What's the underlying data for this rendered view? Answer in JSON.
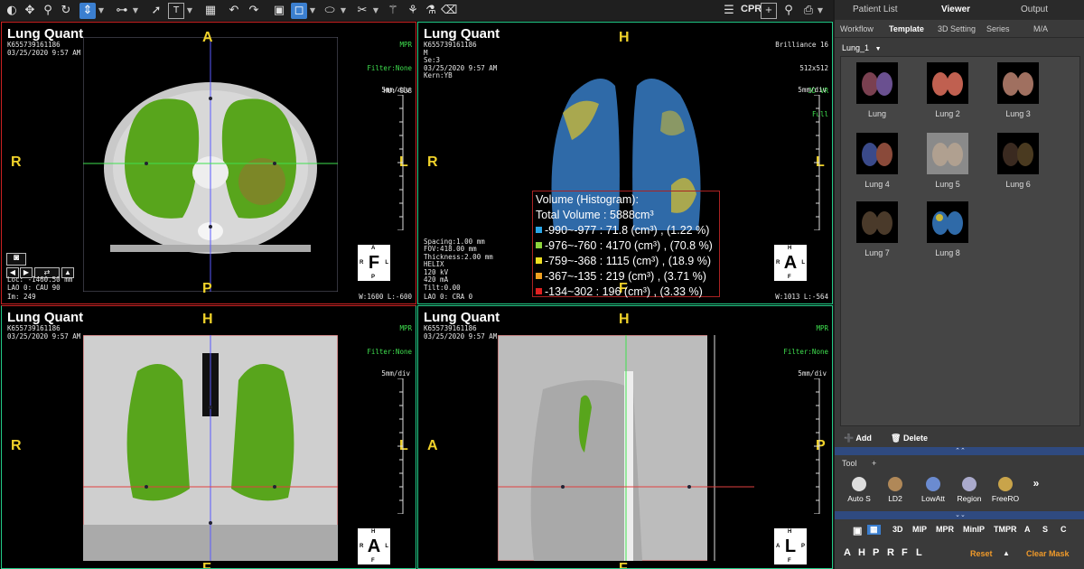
{
  "toolbar": {
    "cpr_label": "CPR"
  },
  "panel": {
    "tabs": [
      "Patient List",
      "Viewer",
      "Output"
    ],
    "selected_tab": "Viewer",
    "sub_tabs": [
      "Workflow",
      "Template",
      "3D Setting",
      "Series",
      "M/A"
    ],
    "selected_sub_tab": "Template",
    "template_select": "Lung_1",
    "thumbnails": [
      {
        "label": "Lung"
      },
      {
        "label": "Lung 2"
      },
      {
        "label": "Lung 3"
      },
      {
        "label": "Lung 4"
      },
      {
        "label": "Lung 5"
      },
      {
        "label": "Lung 6"
      },
      {
        "label": "Lung 7"
      },
      {
        "label": "Lung 8"
      }
    ],
    "add_label": "Add",
    "delete_label": "Delete",
    "tool_header": "Tool",
    "tool_plus": "+",
    "tools": [
      {
        "label": "Auto S",
        "icon": "auto-segment-icon"
      },
      {
        "label": "LD2",
        "icon": "lung-icon"
      },
      {
        "label": "LowAtt",
        "icon": "low-attenuation-icon"
      },
      {
        "label": "Region",
        "icon": "region-icon"
      },
      {
        "label": "FreeRO",
        "icon": "free-roi-icon"
      }
    ],
    "more_label": "»",
    "modes": [
      "3D",
      "MIP",
      "MPR",
      "MinIP",
      "TMPR",
      "A",
      "S",
      "C"
    ],
    "orientations": [
      "A",
      "H",
      "P",
      "R",
      "F",
      "L"
    ],
    "reset_label": "Reset",
    "clear_mask_label": "Clear Mask"
  },
  "viewports": {
    "axial": {
      "title": "Lung Quant",
      "meta": "K655739161186\n03/25/2020 9:57 AM",
      "top_right": [
        "MPR",
        "Filter:None",
        "HU:-938"
      ],
      "orient": {
        "top": "A",
        "bottom": "P",
        "left": "R",
        "right": "L"
      },
      "scale": "5mm/div",
      "bottom_left": "Loc: -1460.50 mm\nLAO 0: CAU 90",
      "image_index": "Im: 249",
      "wl": "W:1600 L:-600",
      "cube": {
        "big": "F",
        "top": "A",
        "bottom": "P",
        "left": "R",
        "right": "L"
      }
    },
    "vr": {
      "title": "Lung Quant",
      "meta": "K655739161186\nM\nSe:3\n03/25/2020 9:57 AM\nKern:YB",
      "top_right": [
        "Brilliance 16",
        "512x512",
        "3D VR",
        "Full"
      ],
      "orient": {
        "top": "H",
        "bottom": "F",
        "left": "R",
        "right": "L"
      },
      "scale": "5mm/div",
      "bottom_left": "Spacing:1.00 mm\nFOV:418.00 mm\nThickness:2.00 mm\nHELIX\n120 kV\n420 mA\nTilt:0.00",
      "view_angle": "LAO 0: CRA 0",
      "wl": "W:1013 L:-564",
      "cube": {
        "big": "A",
        "top": "H",
        "bottom": "F",
        "left": "R",
        "right": "L"
      },
      "histogram": {
        "title": "Volume (Histogram):",
        "total": "Total Volume : 5888cm³",
        "rows": [
          {
            "text": "-990~-977 : 71.8 (cm³) , (1.22 %)",
            "color": "#2aa6e8"
          },
          {
            "text": "-976~-760 : 4170 (cm³) , (70.8 %)",
            "color": "#8ed33c"
          },
          {
            "text": "-759~-368 : 1115 (cm³) , (18.9 %)",
            "color": "#f0e020"
          },
          {
            "text": "-367~-135 : 219 (cm³) , (3.71 %)",
            "color": "#f0a020"
          },
          {
            "text": "-134~302 : 196 (cm³) , (3.33 %)",
            "color": "#e02020"
          }
        ]
      }
    },
    "coronal": {
      "title": "Lung Quant",
      "meta": "K655739161186\n03/25/2020 9:57 AM",
      "top_right": [
        "MPR",
        "Filter:None"
      ],
      "orient": {
        "top": "H",
        "bottom": "F",
        "left": "R",
        "right": "L"
      },
      "scale": "5mm/div",
      "cube": {
        "big": "A",
        "top": "H",
        "bottom": "F",
        "left": "R",
        "right": "L"
      }
    },
    "sagittal": {
      "title": "Lung Quant",
      "meta": "K655739161186\n03/25/2020 9:57 AM",
      "top_right": [
        "MPR",
        "Filter:None"
      ],
      "orient": {
        "top": "H",
        "bottom": "F",
        "left": "A",
        "right": "P"
      },
      "scale": "5mm/div",
      "cube": {
        "big": "L",
        "top": "H",
        "bottom": "F",
        "left": "A",
        "right": "P"
      }
    }
  }
}
